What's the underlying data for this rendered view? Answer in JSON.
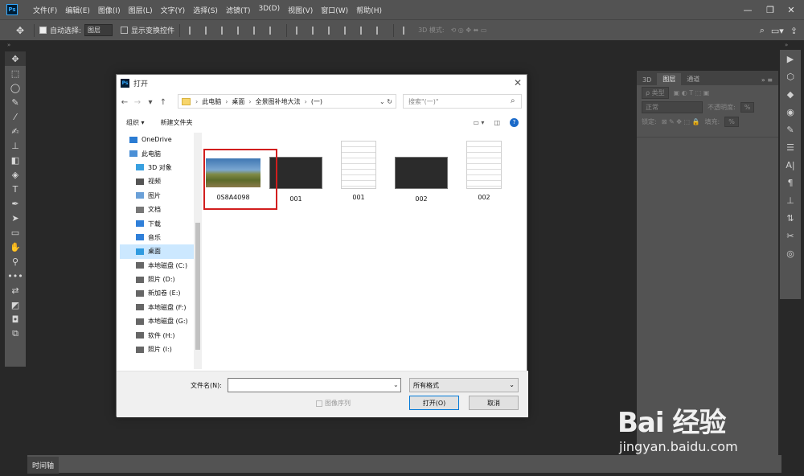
{
  "app": {
    "menu": [
      "文件(F)",
      "编辑(E)",
      "图像(I)",
      "图层(L)",
      "文字(Y)",
      "选择(S)",
      "滤镜(T)",
      "3D(D)",
      "视图(V)",
      "窗口(W)",
      "帮助(H)"
    ],
    "logo": "Ps"
  },
  "options": {
    "auto_select": "自动选择:",
    "layer_select": "图层",
    "show_transform": "显示变换控件",
    "mode_3d": "3D 模式:"
  },
  "panels": {
    "tabs": [
      "3D",
      "图层",
      "通道"
    ],
    "kind": "ρ 类型",
    "blend": "正常",
    "opacity_label": "不透明度:",
    "lock_label": "锁定:",
    "fill_label": "填充:"
  },
  "timeline": {
    "label": "时间轴"
  },
  "dialog": {
    "title": "打开",
    "breadcrumb": [
      "此电脑",
      "桌面",
      "全景图补地大法",
      "(一)"
    ],
    "search_placeholder": "搜索\"(一)\"",
    "organize": "组织 ▾",
    "new_folder": "新建文件夹",
    "nav_items": [
      {
        "label": "OneDrive",
        "icon": "cloud-icon"
      },
      {
        "label": "此电脑",
        "icon": "computer-icon"
      },
      {
        "label": "3D 对象",
        "icon": "cube-icon"
      },
      {
        "label": "视频",
        "icon": "video-icon"
      },
      {
        "label": "图片",
        "icon": "picture-icon"
      },
      {
        "label": "文档",
        "icon": "document-icon"
      },
      {
        "label": "下载",
        "icon": "download-icon"
      },
      {
        "label": "音乐",
        "icon": "music-icon"
      },
      {
        "label": "桌面",
        "icon": "desktop-icon"
      },
      {
        "label": "本地磁盘 (C:)",
        "icon": "drive-icon"
      },
      {
        "label": "照片 (D:)",
        "icon": "drive-icon"
      },
      {
        "label": "新加卷 (E:)",
        "icon": "drive-icon"
      },
      {
        "label": "本地磁盘 (F:)",
        "icon": "drive-icon"
      },
      {
        "label": "本地磁盘 (G:)",
        "icon": "drive-icon"
      },
      {
        "label": "软件 (H:)",
        "icon": "drive-icon"
      },
      {
        "label": "照片 (I:)",
        "icon": "drive-icon"
      }
    ],
    "files": [
      {
        "name": "0S8A4098",
        "kind": "photo"
      },
      {
        "name": "001",
        "kind": "screenshot"
      },
      {
        "name": "001",
        "kind": "document"
      },
      {
        "name": "002",
        "kind": "screenshot"
      },
      {
        "name": "002",
        "kind": "document"
      }
    ],
    "filename_label": "文件名(N):",
    "filename_value": "",
    "format": "所有格式",
    "sequence_label": "图像序列",
    "open_button": "打开(O)",
    "cancel_button": "取消"
  },
  "watermark": {
    "text": "Bai 经验",
    "url": "jingyan.baidu.com"
  },
  "colors": {
    "ps_blue": "#31a8ff",
    "highlight": "#d21e1e",
    "selection": "#cce8ff"
  }
}
